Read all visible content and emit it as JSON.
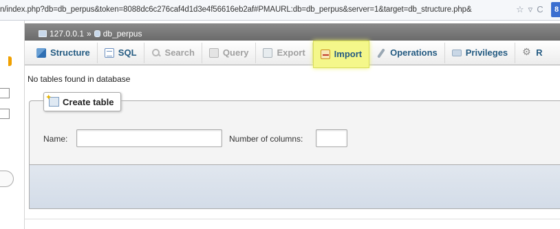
{
  "browser": {
    "url": "n/index.php?db=db_perpus&token=8088dc6c276caf4d1d3e4f56616eb2af#PMAURL:db=db_perpus&server=1&target=db_structure.php&",
    "star_icon": "star-icon",
    "dropdown_icon": "triangle-down-icon",
    "reload_icon": "reload-icon"
  },
  "breadcrumb": {
    "server": "127.0.0.1",
    "separator": "»",
    "database": "db_perpus"
  },
  "tabs": [
    {
      "label": "Structure",
      "icon": "structure-icon",
      "state": "active"
    },
    {
      "label": "SQL",
      "icon": "sql-icon",
      "state": "normal"
    },
    {
      "label": "Search",
      "icon": "search-icon",
      "state": "disabled"
    },
    {
      "label": "Query",
      "icon": "query-icon",
      "state": "disabled"
    },
    {
      "label": "Export",
      "icon": "export-icon",
      "state": "disabled"
    },
    {
      "label": "Import",
      "icon": "import-icon",
      "state": "highlighted"
    },
    {
      "label": "Operations",
      "icon": "operations-icon",
      "state": "normal"
    },
    {
      "label": "Privileges",
      "icon": "privileges-icon",
      "state": "normal"
    },
    {
      "label": "R",
      "icon": "routines-icon",
      "state": "normal"
    }
  ],
  "main": {
    "message": "No tables found in database",
    "create_table": {
      "legend": "Create table",
      "name_label": "Name:",
      "name_value": "",
      "columns_label": "Number of columns:",
      "columns_value": ""
    }
  },
  "colors": {
    "highlight": "#f4f78a",
    "link": "#235a81",
    "breadcrumb_bg": "#777777"
  }
}
